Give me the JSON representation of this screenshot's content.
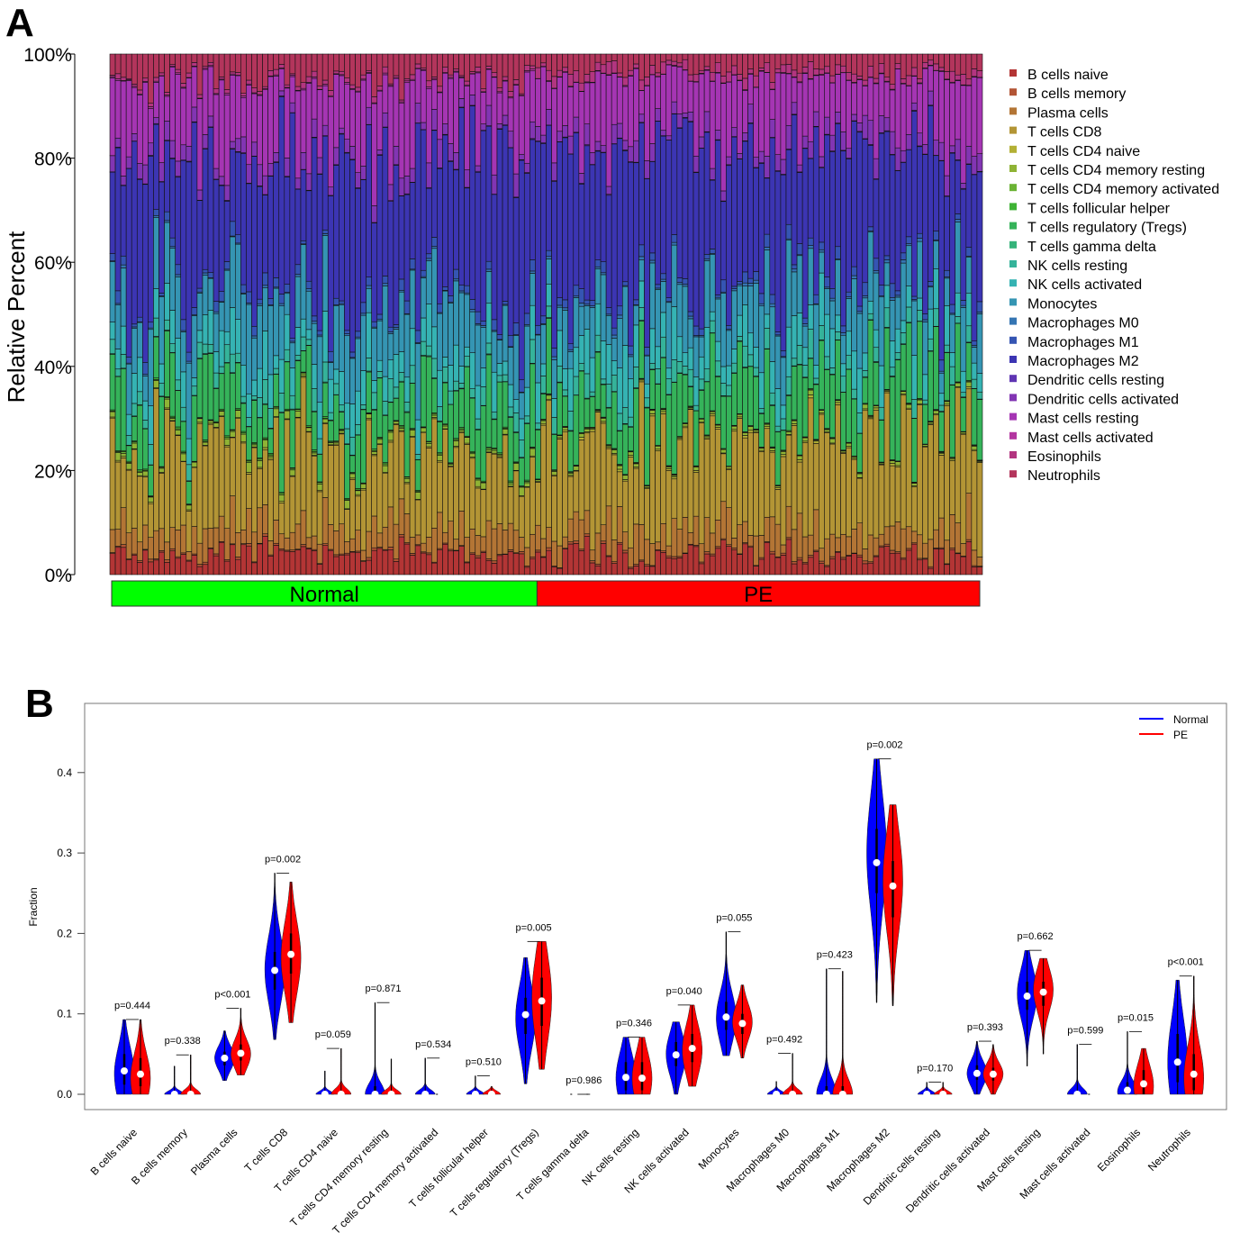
{
  "panels": {
    "a_label": "A",
    "b_label": "B"
  },
  "chart_data": [
    {
      "type": "bar",
      "subtype": "stacked-100-percent",
      "panel": "A",
      "ylabel": "Relative Percent",
      "yticks": [
        "0%",
        "20%",
        "40%",
        "60%",
        "80%",
        "100%"
      ],
      "ylim": [
        0,
        100
      ],
      "groups": [
        {
          "name": "Normal",
          "n_samples": 78,
          "color": "#00ff00"
        },
        {
          "name": "PE",
          "n_samples": 82,
          "color": "#ff0000"
        }
      ],
      "legend_position": "right",
      "cell_types": [
        {
          "name": "B cells naive",
          "color": "#b33535",
          "mean_pct_normal": 4,
          "mean_pct_pe": 4
        },
        {
          "name": "B cells memory",
          "color": "#b35535",
          "mean_pct_normal": 0.3,
          "mean_pct_pe": 0.3
        },
        {
          "name": "Plasma cells",
          "color": "#b37535",
          "mean_pct_normal": 4.5,
          "mean_pct_pe": 5
        },
        {
          "name": "T cells CD8",
          "color": "#b39535",
          "mean_pct_normal": 15.5,
          "mean_pct_pe": 17.5
        },
        {
          "name": "T cells CD4 naive",
          "color": "#b3b035",
          "mean_pct_normal": 0.2,
          "mean_pct_pe": 0.3
        },
        {
          "name": "T cells CD4 memory resting",
          "color": "#8fb335",
          "mean_pct_normal": 1,
          "mean_pct_pe": 0.5
        },
        {
          "name": "T cells CD4 memory activated",
          "color": "#6bb335",
          "mean_pct_normal": 0.2,
          "mean_pct_pe": 0.1
        },
        {
          "name": "T cells follicular helper",
          "color": "#3fb335",
          "mean_pct_normal": 0.2,
          "mean_pct_pe": 0.1
        },
        {
          "name": "T cells regulatory (Tregs)",
          "color": "#35b35a",
          "mean_pct_normal": 10,
          "mean_pct_pe": 11.5
        },
        {
          "name": "T cells gamma delta",
          "color": "#35b37a",
          "mean_pct_normal": 0.1,
          "mean_pct_pe": 0.1
        },
        {
          "name": "NK cells resting",
          "color": "#35b39a",
          "mean_pct_normal": 2.5,
          "mean_pct_pe": 2.5
        },
        {
          "name": "NK cells activated",
          "color": "#35b3b3",
          "mean_pct_normal": 5,
          "mean_pct_pe": 6
        },
        {
          "name": "Monocytes",
          "color": "#3595b3",
          "mean_pct_normal": 10,
          "mean_pct_pe": 9
        },
        {
          "name": "Macrophages M0",
          "color": "#3575b3",
          "mean_pct_normal": 0.3,
          "mean_pct_pe": 0.4
        },
        {
          "name": "Macrophages M1",
          "color": "#3555b3",
          "mean_pct_normal": 1.5,
          "mean_pct_pe": 1.5
        },
        {
          "name": "Macrophages M2",
          "color": "#3c35b3",
          "mean_pct_normal": 28.5,
          "mean_pct_pe": 25.5
        },
        {
          "name": "Dendritic cells resting",
          "color": "#5f35b3",
          "mean_pct_normal": 0.1,
          "mean_pct_pe": 0.1
        },
        {
          "name": "Dendritic cells activated",
          "color": "#8235b3",
          "mean_pct_normal": 2.7,
          "mean_pct_pe": 2.6
        },
        {
          "name": "Mast cells resting",
          "color": "#a535b3",
          "mean_pct_normal": 12,
          "mean_pct_pe": 12.5
        },
        {
          "name": "Mast cells activated",
          "color": "#b335a0",
          "mean_pct_normal": 0.2,
          "mean_pct_pe": 0.1
        },
        {
          "name": "Eosinophils",
          "color": "#b33580",
          "mean_pct_normal": 0.7,
          "mean_pct_pe": 1.5
        },
        {
          "name": "Neutrophils",
          "color": "#b3355c",
          "mean_pct_normal": 5,
          "mean_pct_pe": 3
        }
      ]
    },
    {
      "type": "violin",
      "panel": "B",
      "ylabel": "Fraction",
      "ylim": [
        -0.02,
        0.47
      ],
      "yticks": [
        "0.0",
        "0.1",
        "0.2",
        "0.3",
        "0.4"
      ],
      "ytick_values": [
        0,
        0.1,
        0.2,
        0.3,
        0.4
      ],
      "legend_position": "top-right",
      "legend": [
        {
          "name": "Normal",
          "color": "#0000ff"
        },
        {
          "name": "PE",
          "color": "#ff0000"
        }
      ],
      "categories": [
        {
          "name": "B cells naive",
          "p": "p=0.444",
          "normal": {
            "min": 0,
            "max": 0.093,
            "median": 0.029,
            "q1": 0.012,
            "q3": 0.05,
            "mode": 0.025
          },
          "pe": {
            "min": 0,
            "max": 0.093,
            "median": 0.025,
            "q1": 0.01,
            "q3": 0.045,
            "mode": 0.02
          }
        },
        {
          "name": "B cells memory",
          "p": "p=0.338",
          "normal": {
            "min": 0,
            "max": 0.035,
            "median": 0.0,
            "q1": 0,
            "q3": 0.001,
            "mode": 0
          },
          "pe": {
            "min": 0,
            "max": 0.049,
            "median": 0.0,
            "q1": 0,
            "q3": 0.001,
            "mode": 0
          }
        },
        {
          "name": "Plasma cells",
          "p": "p<0.001",
          "normal": {
            "min": 0.017,
            "max": 0.079,
            "median": 0.045,
            "q1": 0.036,
            "q3": 0.053,
            "mode": 0.045
          },
          "pe": {
            "min": 0.024,
            "max": 0.107,
            "median": 0.051,
            "q1": 0.042,
            "q3": 0.062,
            "mode": 0.05
          }
        },
        {
          "name": "T cells CD8",
          "p": "p=0.002",
          "normal": {
            "min": 0.068,
            "max": 0.275,
            "median": 0.154,
            "q1": 0.13,
            "q3": 0.177,
            "mode": 0.155
          },
          "pe": {
            "min": 0.089,
            "max": 0.264,
            "median": 0.174,
            "q1": 0.15,
            "q3": 0.2,
            "mode": 0.17
          }
        },
        {
          "name": "T cells CD4 naive",
          "p": "p=0.059",
          "normal": {
            "min": 0,
            "max": 0.029,
            "median": 0.0,
            "q1": 0,
            "q3": 0.001,
            "mode": 0
          },
          "pe": {
            "min": 0,
            "max": 0.057,
            "median": 0.0,
            "q1": 0,
            "q3": 0.003,
            "mode": 0
          }
        },
        {
          "name": "T cells CD4 memory resting",
          "p": "p=0.871",
          "normal": {
            "min": 0,
            "max": 0.114,
            "median": 0.0,
            "q1": 0,
            "q3": 0.01,
            "mode": 0
          },
          "pe": {
            "min": 0,
            "max": 0.044,
            "median": 0.0,
            "q1": 0,
            "q3": 0.003,
            "mode": 0
          }
        },
        {
          "name": "T cells CD4 memory activated",
          "p": "p=0.534",
          "normal": {
            "min": 0,
            "max": 0.045,
            "median": 0.0,
            "q1": 0,
            "q3": 0.001,
            "mode": 0
          },
          "pe": {
            "min": 0,
            "max": 0.0,
            "median": 0.0,
            "q1": 0,
            "q3": 0,
            "mode": 0
          }
        },
        {
          "name": "T cells follicular helper",
          "p": "p=0.510",
          "normal": {
            "min": 0,
            "max": 0.023,
            "median": 0.0,
            "q1": 0,
            "q3": 0.0,
            "mode": 0
          },
          "pe": {
            "min": 0,
            "max": 0.01,
            "median": 0.0,
            "q1": 0,
            "q3": 0.0,
            "mode": 0
          }
        },
        {
          "name": "T cells regulatory (Tregs)",
          "p": "p=0.005",
          "normal": {
            "min": 0.013,
            "max": 0.17,
            "median": 0.099,
            "q1": 0.075,
            "q3": 0.12,
            "mode": 0.095
          },
          "pe": {
            "min": 0.031,
            "max": 0.19,
            "median": 0.116,
            "q1": 0.085,
            "q3": 0.145,
            "mode": 0.12
          }
        },
        {
          "name": "T cells gamma delta",
          "p": "p=0.986",
          "normal": {
            "min": 0,
            "max": 0.0,
            "median": 0.0,
            "q1": 0,
            "q3": 0,
            "mode": 0
          },
          "pe": {
            "min": 0,
            "max": 0.0,
            "median": 0.0,
            "q1": 0,
            "q3": 0,
            "mode": 0
          }
        },
        {
          "name": "NK cells resting",
          "p": "p=0.346",
          "normal": {
            "min": 0,
            "max": 0.071,
            "median": 0.021,
            "q1": 0.005,
            "q3": 0.04,
            "mode": 0.02
          },
          "pe": {
            "min": 0,
            "max": 0.071,
            "median": 0.02,
            "q1": 0.005,
            "q3": 0.04,
            "mode": 0.02
          }
        },
        {
          "name": "NK cells activated",
          "p": "p=0.040",
          "normal": {
            "min": 0.0,
            "max": 0.09,
            "median": 0.049,
            "q1": 0.035,
            "q3": 0.065,
            "mode": 0.05
          },
          "pe": {
            "min": 0.01,
            "max": 0.111,
            "median": 0.057,
            "q1": 0.04,
            "q3": 0.075,
            "mode": 0.055
          }
        },
        {
          "name": "Monocytes",
          "p": "p=0.055",
          "normal": {
            "min": 0.048,
            "max": 0.202,
            "median": 0.096,
            "q1": 0.08,
            "q3": 0.115,
            "mode": 0.095
          },
          "pe": {
            "min": 0.045,
            "max": 0.136,
            "median": 0.088,
            "q1": 0.075,
            "q3": 0.1,
            "mode": 0.09
          }
        },
        {
          "name": "Macrophages M0",
          "p": "p=0.492",
          "normal": {
            "min": 0,
            "max": 0.016,
            "median": 0.0,
            "q1": 0,
            "q3": 0.0,
            "mode": 0
          },
          "pe": {
            "min": 0,
            "max": 0.051,
            "median": 0.0,
            "q1": 0,
            "q3": 0.002,
            "mode": 0
          }
        },
        {
          "name": "Macrophages M1",
          "p": "p=0.423",
          "normal": {
            "min": 0,
            "max": 0.156,
            "median": 0.0,
            "q1": 0,
            "q3": 0.01,
            "mode": 0
          },
          "pe": {
            "min": 0,
            "max": 0.153,
            "median": 0.0,
            "q1": 0,
            "q3": 0.01,
            "mode": 0
          }
        },
        {
          "name": "Macrophages M2",
          "p": "p=0.002",
          "normal": {
            "min": 0.114,
            "max": 0.417,
            "median": 0.288,
            "q1": 0.25,
            "q3": 0.33,
            "mode": 0.3
          },
          "pe": {
            "min": 0.11,
            "max": 0.36,
            "median": 0.259,
            "q1": 0.22,
            "q3": 0.29,
            "mode": 0.265
          }
        },
        {
          "name": "Dendritic cells resting",
          "p": "p=0.170",
          "normal": {
            "min": 0,
            "max": 0.015,
            "median": 0.0,
            "q1": 0,
            "q3": 0.0,
            "mode": 0
          },
          "pe": {
            "min": 0,
            "max": 0.015,
            "median": 0.0,
            "q1": 0,
            "q3": 0.0,
            "mode": 0
          }
        },
        {
          "name": "Dendritic cells activated",
          "p": "p=0.393",
          "normal": {
            "min": 0,
            "max": 0.066,
            "median": 0.026,
            "q1": 0.018,
            "q3": 0.036,
            "mode": 0.026
          },
          "pe": {
            "min": 0,
            "max": 0.062,
            "median": 0.025,
            "q1": 0.017,
            "q3": 0.033,
            "mode": 0.025
          }
        },
        {
          "name": "Mast cells resting",
          "p": "p=0.662",
          "normal": {
            "min": 0.035,
            "max": 0.179,
            "median": 0.122,
            "q1": 0.105,
            "q3": 0.14,
            "mode": 0.125
          },
          "pe": {
            "min": 0.05,
            "max": 0.169,
            "median": 0.127,
            "q1": 0.11,
            "q3": 0.14,
            "mode": 0.13
          }
        },
        {
          "name": "Mast cells activated",
          "p": "p=0.599",
          "normal": {
            "min": 0,
            "max": 0.062,
            "median": 0.0,
            "q1": 0,
            "q3": 0.001,
            "mode": 0
          },
          "pe": {
            "min": 0,
            "max": 0.0,
            "median": 0.0,
            "q1": 0,
            "q3": 0,
            "mode": 0
          }
        },
        {
          "name": "Eosinophils",
          "p": "p=0.015",
          "normal": {
            "min": 0,
            "max": 0.078,
            "median": 0.005,
            "q1": 0.0,
            "q3": 0.015,
            "mode": 0.003
          },
          "pe": {
            "min": 0,
            "max": 0.057,
            "median": 0.013,
            "q1": 0.0,
            "q3": 0.03,
            "mode": 0.01
          }
        },
        {
          "name": "Neutrophils",
          "p": "p<0.001",
          "normal": {
            "min": 0,
            "max": 0.142,
            "median": 0.04,
            "q1": 0.015,
            "q3": 0.075,
            "mode": 0.04
          },
          "pe": {
            "min": 0,
            "max": 0.147,
            "median": 0.025,
            "q1": 0.005,
            "q3": 0.05,
            "mode": 0.02
          }
        }
      ]
    }
  ]
}
